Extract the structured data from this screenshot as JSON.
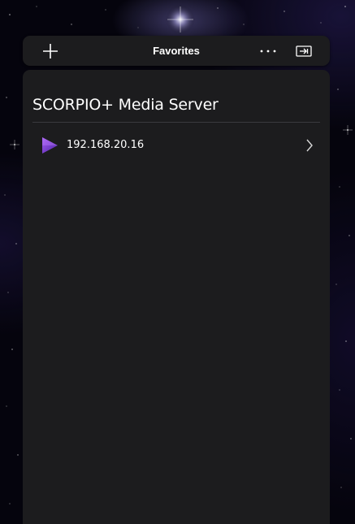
{
  "toolbar": {
    "title": "Favorites",
    "icons": {
      "add": "plus-icon",
      "more": "more-horizontal-icon",
      "cast": "cast-to-device-icon"
    }
  },
  "server": {
    "name": "SCORPIO+ Media Server",
    "items": [
      {
        "label": "192.168.20.16",
        "icon": "play-icon",
        "trailing_icon": "chevron-right-icon"
      }
    ]
  },
  "colors": {
    "background": "#05040d",
    "surface": "#1c1c1e",
    "divider": "#3a3a3e",
    "accent_play_start": "#9b54e6",
    "accent_play_end": "#5b2bb8",
    "text": "#ffffff"
  }
}
